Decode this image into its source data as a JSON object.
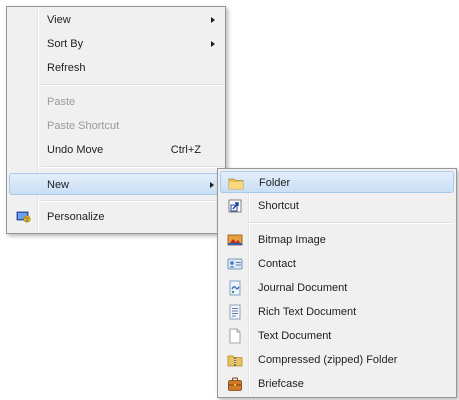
{
  "main_menu": {
    "items": [
      {
        "label": "View",
        "submenu": true
      },
      {
        "label": "Sort By",
        "submenu": true
      },
      {
        "label": "Refresh"
      },
      {
        "label": "Paste",
        "disabled": true
      },
      {
        "label": "Paste Shortcut",
        "disabled": true
      },
      {
        "label": "Undo Move",
        "shortcut": "Ctrl+Z"
      },
      {
        "label": "New",
        "submenu": true,
        "highlighted": true
      },
      {
        "label": "Personalize",
        "icon": "personalize-icon"
      }
    ]
  },
  "new_submenu": {
    "items": [
      {
        "label": "Folder",
        "icon": "folder-icon",
        "highlighted": true
      },
      {
        "label": "Shortcut",
        "icon": "shortcut-icon"
      },
      {
        "label": "Bitmap Image",
        "icon": "bitmap-image-icon"
      },
      {
        "label": "Contact",
        "icon": "contact-icon"
      },
      {
        "label": "Journal Document",
        "icon": "journal-document-icon"
      },
      {
        "label": "Rich Text Document",
        "icon": "rich-text-document-icon"
      },
      {
        "label": "Text Document",
        "icon": "text-document-icon"
      },
      {
        "label": "Compressed (zipped) Folder",
        "icon": "compressed-folder-icon"
      },
      {
        "label": "Briefcase",
        "icon": "briefcase-icon"
      }
    ]
  },
  "colors": {
    "menu_background": "#f0f0f0",
    "highlight": "#c9def5",
    "highlight_border": "#a8c8ec",
    "disabled_text": "#9a9a9a"
  }
}
